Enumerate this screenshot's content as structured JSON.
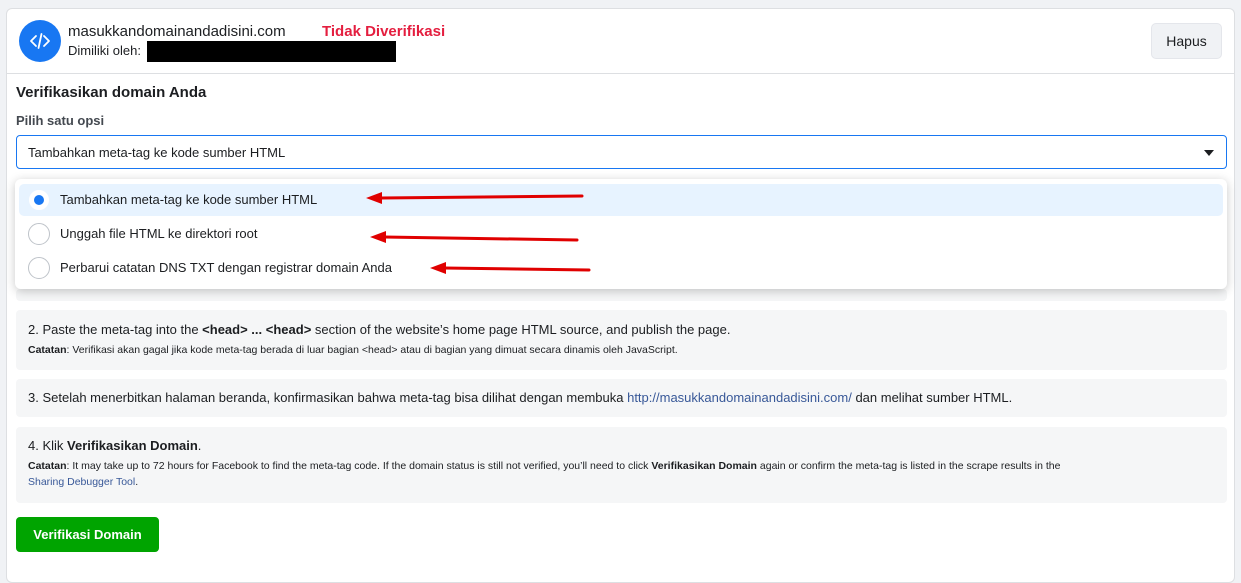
{
  "header": {
    "domain": "masukkandomainandadisini.com",
    "status": "Tidak Diverifikasi",
    "owned_by_label": "Dimiliki oleh:",
    "delete_label": "Hapus"
  },
  "verify": {
    "title": "Verifikasikan domain Anda",
    "option_label": "Pilih satu opsi",
    "selected_value": "Tambahkan meta-tag ke kode sumber HTML",
    "options": [
      {
        "label": "Tambahkan meta-tag ke kode sumber HTML",
        "checked": true
      },
      {
        "label": "Unggah file HTML ke direktori root",
        "checked": false
      },
      {
        "label": "Perbarui catatan DNS TXT dengan registrar domain Anda",
        "checked": false
      }
    ]
  },
  "steps": {
    "step2": {
      "prefix": "2. Paste the meta-tag into the ",
      "head_open": "<head> ... <head>",
      "suffix": " section of the website’s home page HTML source, and publish the page.",
      "note_label": "Catatan",
      "note_text": ": Verifikasi akan gagal jika kode meta-tag berada di luar bagian <head> atau di bagian yang dimuat secara dinamis oleh JavaScript."
    },
    "step3": {
      "prefix": "3. Setelah menerbitkan halaman beranda, konfirmasikan bahwa meta-tag bisa dilihat dengan membuka ",
      "link": "http://masukkandomainandadisini.com/",
      "suffix": " dan melihat sumber HTML."
    },
    "step4": {
      "prefix": "4. Klik ",
      "bold": "Verifikasikan Domain",
      "suffix": ".",
      "note_label": "Catatan",
      "note_text_1": ": It may take up to 72 hours for Facebook to find the meta-tag code. If the domain status is still not verified, you’ll need to click ",
      "note_bold": "Verifikasikan Domain",
      "note_text_2": " again or confirm the meta-tag is listed in the scrape results in the",
      "note_link": "Sharing Debugger Tool",
      "note_text_3": "."
    }
  },
  "actions": {
    "verify_button": "Verifikasi Domain"
  },
  "colors": {
    "accent": "#1877f2",
    "unverified": "#e41e3f",
    "verify_button": "#00a400",
    "annotation_arrow": "#e00000"
  },
  "icons": {
    "domain_icon": "code-icon",
    "caret": "caret-down-icon"
  }
}
